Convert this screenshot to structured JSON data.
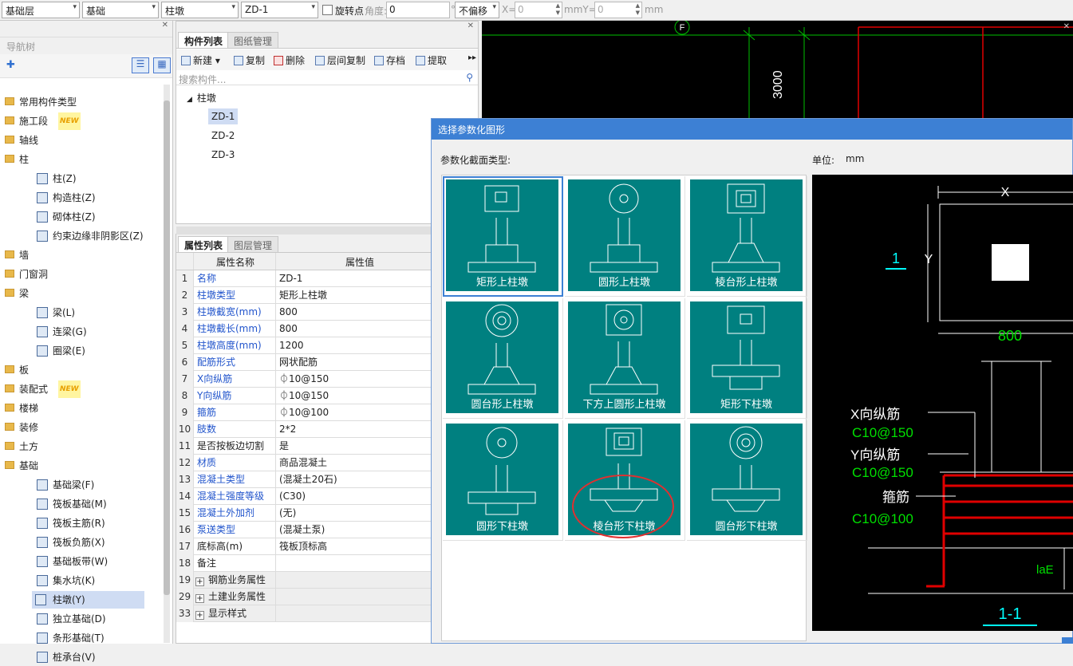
{
  "toolbar": {
    "floor": "基础层",
    "category": "基础",
    "type": "柱墩",
    "component": "ZD-1",
    "rotate_label": "旋转点",
    "angle_label": "角度:",
    "angle_value": "0",
    "degree": "°",
    "offset": "不偏移",
    "x_label": "X=",
    "x_value": "0",
    "mmy_label": "mmY=",
    "y_value": "0",
    "mm_label": "mm"
  },
  "nav": {
    "title": "导航树",
    "new_badge": "NEW",
    "items": [
      {
        "label": "常用构件类型",
        "folder": true
      },
      {
        "label": "施工段",
        "folder": true,
        "new": true
      },
      {
        "label": "轴线",
        "folder": true
      },
      {
        "label": "柱",
        "folder": true
      },
      {
        "label": "柱(Z)"
      },
      {
        "label": "构造柱(Z)"
      },
      {
        "label": "砌体柱(Z)"
      },
      {
        "label": "约束边缘非阴影区(Z)"
      },
      {
        "label": "墙",
        "folder": true
      },
      {
        "label": "门窗洞",
        "folder": true
      },
      {
        "label": "梁",
        "folder": true
      },
      {
        "label": "梁(L)"
      },
      {
        "label": "连梁(G)"
      },
      {
        "label": "圈梁(E)"
      },
      {
        "label": "板",
        "folder": true
      },
      {
        "label": "装配式",
        "folder": true,
        "new": true
      },
      {
        "label": "楼梯",
        "folder": true
      },
      {
        "label": "装修",
        "folder": true
      },
      {
        "label": "土方",
        "folder": true
      },
      {
        "label": "基础",
        "folder": true
      },
      {
        "label": "基础梁(F)"
      },
      {
        "label": "筏板基础(M)"
      },
      {
        "label": "筏板主筋(R)"
      },
      {
        "label": "筏板负筋(X)"
      },
      {
        "label": "基础板带(W)"
      },
      {
        "label": "集水坑(K)"
      },
      {
        "label": "柱墩(Y)",
        "selected": true
      },
      {
        "label": "独立基础(D)"
      },
      {
        "label": "条形基础(T)"
      },
      {
        "label": "桩承台(V)"
      }
    ]
  },
  "components": {
    "tab_active": "构件列表",
    "tab_other": "图纸管理",
    "toolbar": [
      "新建",
      "复制",
      "删除",
      "层间复制",
      "存档",
      "提取"
    ],
    "search_placeholder": "搜索构件...",
    "root": "柱墩",
    "items": [
      "ZD-1",
      "ZD-2",
      "ZD-3"
    ]
  },
  "properties": {
    "tab_active": "属性列表",
    "tab_other": "图层管理",
    "col_name": "属性名称",
    "col_value": "属性值",
    "rows": [
      {
        "n": "1",
        "k": "名称",
        "v": "ZD-1",
        "blue": true
      },
      {
        "n": "2",
        "k": "柱墩类型",
        "v": "矩形上柱墩",
        "blue": true
      },
      {
        "n": "3",
        "k": "柱墩截宽(mm)",
        "v": "800",
        "blue": true
      },
      {
        "n": "4",
        "k": "柱墩截长(mm)",
        "v": "800",
        "blue": true
      },
      {
        "n": "5",
        "k": "柱墩高度(mm)",
        "v": "1200",
        "blue": true
      },
      {
        "n": "6",
        "k": "配筋形式",
        "v": "网状配筋",
        "blue": true
      },
      {
        "n": "7",
        "k": "X向纵筋",
        "v": "⏀10@150",
        "blue": true
      },
      {
        "n": "8",
        "k": "Y向纵筋",
        "v": "⏀10@150",
        "blue": true
      },
      {
        "n": "9",
        "k": "箍筋",
        "v": "⏀10@100",
        "blue": true
      },
      {
        "n": "10",
        "k": "肢数",
        "v": "2*2",
        "blue": true
      },
      {
        "n": "11",
        "k": "是否按板边切割",
        "v": "是",
        "blue": false
      },
      {
        "n": "12",
        "k": "材质",
        "v": "商品混凝土",
        "blue": true
      },
      {
        "n": "13",
        "k": "混凝土类型",
        "v": "(混凝土20石)",
        "blue": true
      },
      {
        "n": "14",
        "k": "混凝土强度等级",
        "v": "(C30)",
        "blue": true
      },
      {
        "n": "15",
        "k": "混凝土外加剂",
        "v": "(无)",
        "blue": true
      },
      {
        "n": "16",
        "k": "泵送类型",
        "v": "(混凝土泵)",
        "blue": true
      },
      {
        "n": "17",
        "k": "底标高(m)",
        "v": "筏板顶标高",
        "blue": false
      },
      {
        "n": "18",
        "k": "备注",
        "v": "",
        "blue": false
      },
      {
        "n": "19",
        "k": "钢筋业务属性",
        "v": "",
        "group": true
      },
      {
        "n": "29",
        "k": "土建业务属性",
        "v": "",
        "group": true
      },
      {
        "n": "33",
        "k": "显示样式",
        "v": "",
        "group": true
      }
    ]
  },
  "cad": {
    "axis_label": "F",
    "dimension": "3000"
  },
  "dialog": {
    "title": "选择参数化图形",
    "section_label": "参数化截面类型:",
    "unit_label": "单位:",
    "unit_value": "mm",
    "shapes": [
      "矩形上柱墩",
      "圆形上柱墩",
      "棱台形上柱墩",
      "圆台形上柱墩",
      "下方上圆形上柱墩",
      "矩形下柱墩",
      "圆形下柱墩",
      "棱台形下柱墩",
      "圆台形下柱墩"
    ],
    "preview": {
      "dim_x": "X",
      "dim_y": "Y",
      "width": "800",
      "section_mark": "1",
      "x_rebar": "X向纵筋",
      "x_rebar_spec": "C10@150",
      "y_rebar": "Y向纵筋",
      "y_rebar_spec": "C10@150",
      "stirrup": "箍筋",
      "stirrup_spec": "C10@100",
      "lae": "laE",
      "section_title": "1-1"
    }
  },
  "colors": {
    "tile": "#008080",
    "highlight_circle": "#e03030",
    "cad_green": "#00c000",
    "cad_red": "#e00000",
    "cad_cyan": "#00ffff"
  }
}
